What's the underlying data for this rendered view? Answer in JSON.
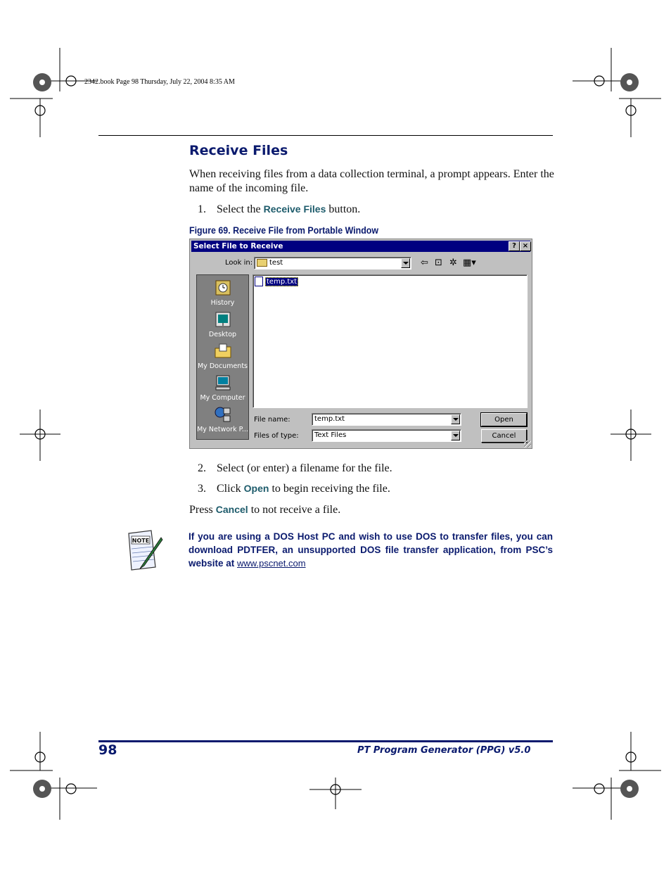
{
  "slug": "2342.book  Page 98  Thursday, July 22, 2004  8:35 AM",
  "heading": "Receive Files",
  "intro": "When receiving files from a data collection terminal, a prompt appears. Enter the name of the incoming file.",
  "steps": [
    {
      "num": "1.",
      "pre": "Select the ",
      "kw": "Receive Files",
      "post": " button."
    },
    {
      "num": "2.",
      "pre": "Select (or enter) a filename for the file.",
      "kw": "",
      "post": ""
    },
    {
      "num": "3.",
      "pre": "Click ",
      "kw": "Open",
      "post": " to begin receiving the file."
    }
  ],
  "figure_caption": "Figure 69. Receive File from Portable Window",
  "dialog": {
    "title": "Select File to Receive",
    "help_btn": "?",
    "close_btn": "×",
    "look_in_label": "Look in:",
    "look_in_value": "test",
    "places": [
      "History",
      "Desktop",
      "My Documents",
      "My Computer",
      "My Network P..."
    ],
    "files": [
      "temp.txt"
    ],
    "file_name_label": "File name:",
    "file_name_value": "temp.txt",
    "file_type_label": "Files of type:",
    "file_type_value": "Text Files",
    "open_btn": "Open",
    "cancel_btn": "Cancel"
  },
  "press_pre": "Press ",
  "press_kw": "Cancel",
  "press_post": " to not receive a file.",
  "note": {
    "icon_label": "NOTE",
    "text": "If you are using a DOS Host PC and wish to use DOS to transfer files, you can download PDTFER, an unsupported DOS file transfer application, from PSC’s website at ",
    "link": "www.pscnet.com"
  },
  "footer": {
    "page_number": "98",
    "title": "PT Program Generator (PPG)  v5.0"
  }
}
